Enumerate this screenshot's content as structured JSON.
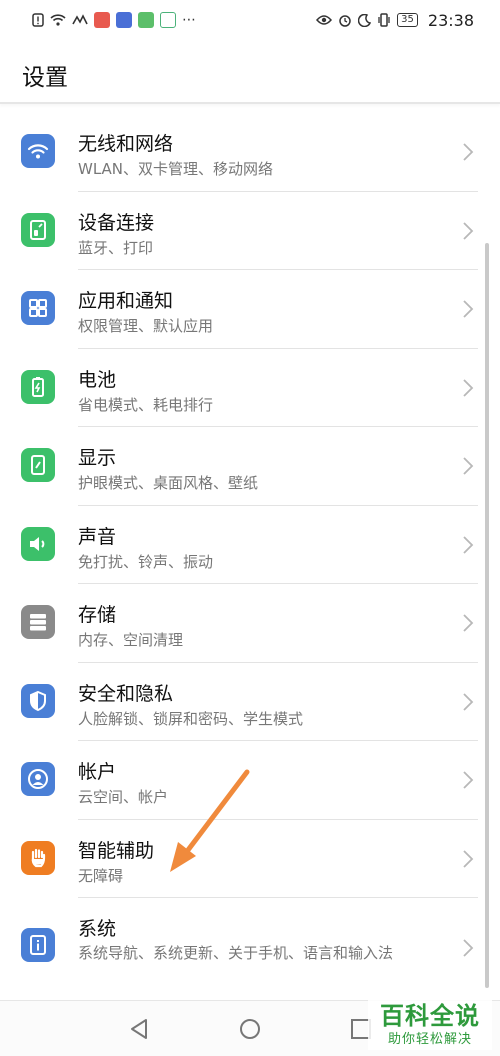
{
  "status_bar": {
    "battery": "35",
    "time": "23:38"
  },
  "header": {
    "title": "设置"
  },
  "items": [
    {
      "label": "无线和网络",
      "sub": "WLAN、双卡管理、移动网络",
      "icon": "wifi-icon",
      "color": "#4a7fd6"
    },
    {
      "label": "设备连接",
      "sub": "蓝牙、打印",
      "icon": "device-connect-icon",
      "color": "#3cc06a"
    },
    {
      "label": "应用和通知",
      "sub": "权限管理、默认应用",
      "icon": "apps-grid-icon",
      "color": "#4a7fd6"
    },
    {
      "label": "电池",
      "sub": "省电模式、耗电排行",
      "icon": "battery-icon",
      "color": "#3cc06a"
    },
    {
      "label": "显示",
      "sub": "护眼模式、桌面风格、壁纸",
      "icon": "display-icon",
      "color": "#3cc06a"
    },
    {
      "label": "声音",
      "sub": "免打扰、铃声、振动",
      "icon": "speaker-icon",
      "color": "#3cc06a"
    },
    {
      "label": "存储",
      "sub": "内存、空间清理",
      "icon": "storage-icon",
      "color": "#8a8a8a"
    },
    {
      "label": "安全和隐私",
      "sub": "人脸解锁、锁屏和密码、学生模式",
      "icon": "shield-icon",
      "color": "#4a7fd6"
    },
    {
      "label": "帐户",
      "sub": "云空间、帐户",
      "icon": "account-icon",
      "color": "#4a7fd6"
    },
    {
      "label": "智能辅助",
      "sub": "无障碍",
      "icon": "hand-icon",
      "color": "#ef7d22"
    },
    {
      "label": "系统",
      "sub": "系统导航、系统更新、关于手机、语言和输入法",
      "icon": "info-icon",
      "color": "#4a7fd6"
    }
  ],
  "watermark": {
    "title": "百科全说",
    "sub": "助你轻松解决"
  },
  "colors": {
    "annotation_arrow": "#f08a3c",
    "watermark": "#2e9a3c"
  }
}
